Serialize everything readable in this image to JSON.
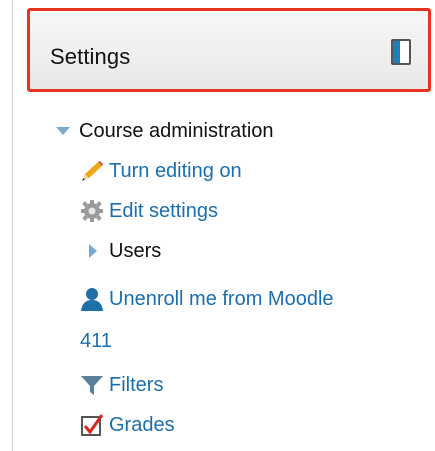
{
  "block": {
    "title": "Settings"
  },
  "tree": {
    "root_label": "Course administration",
    "items": [
      {
        "label": "Turn editing on",
        "icon": "pencil-icon"
      },
      {
        "label": "Edit settings",
        "icon": "gear-icon"
      },
      {
        "label": "Users",
        "icon": "expand-arrow-icon"
      },
      {
        "label": "Unenroll me from Moodle",
        "label_cont": "411",
        "icon": "user-icon"
      },
      {
        "label": "Filters",
        "icon": "filter-icon"
      },
      {
        "label": "Grades",
        "icon": "grades-checkbox-icon"
      }
    ]
  },
  "colors": {
    "link": "#1a6fb0",
    "highlight_border": "#e8331f",
    "dock_bar": "#1f7fbe"
  }
}
